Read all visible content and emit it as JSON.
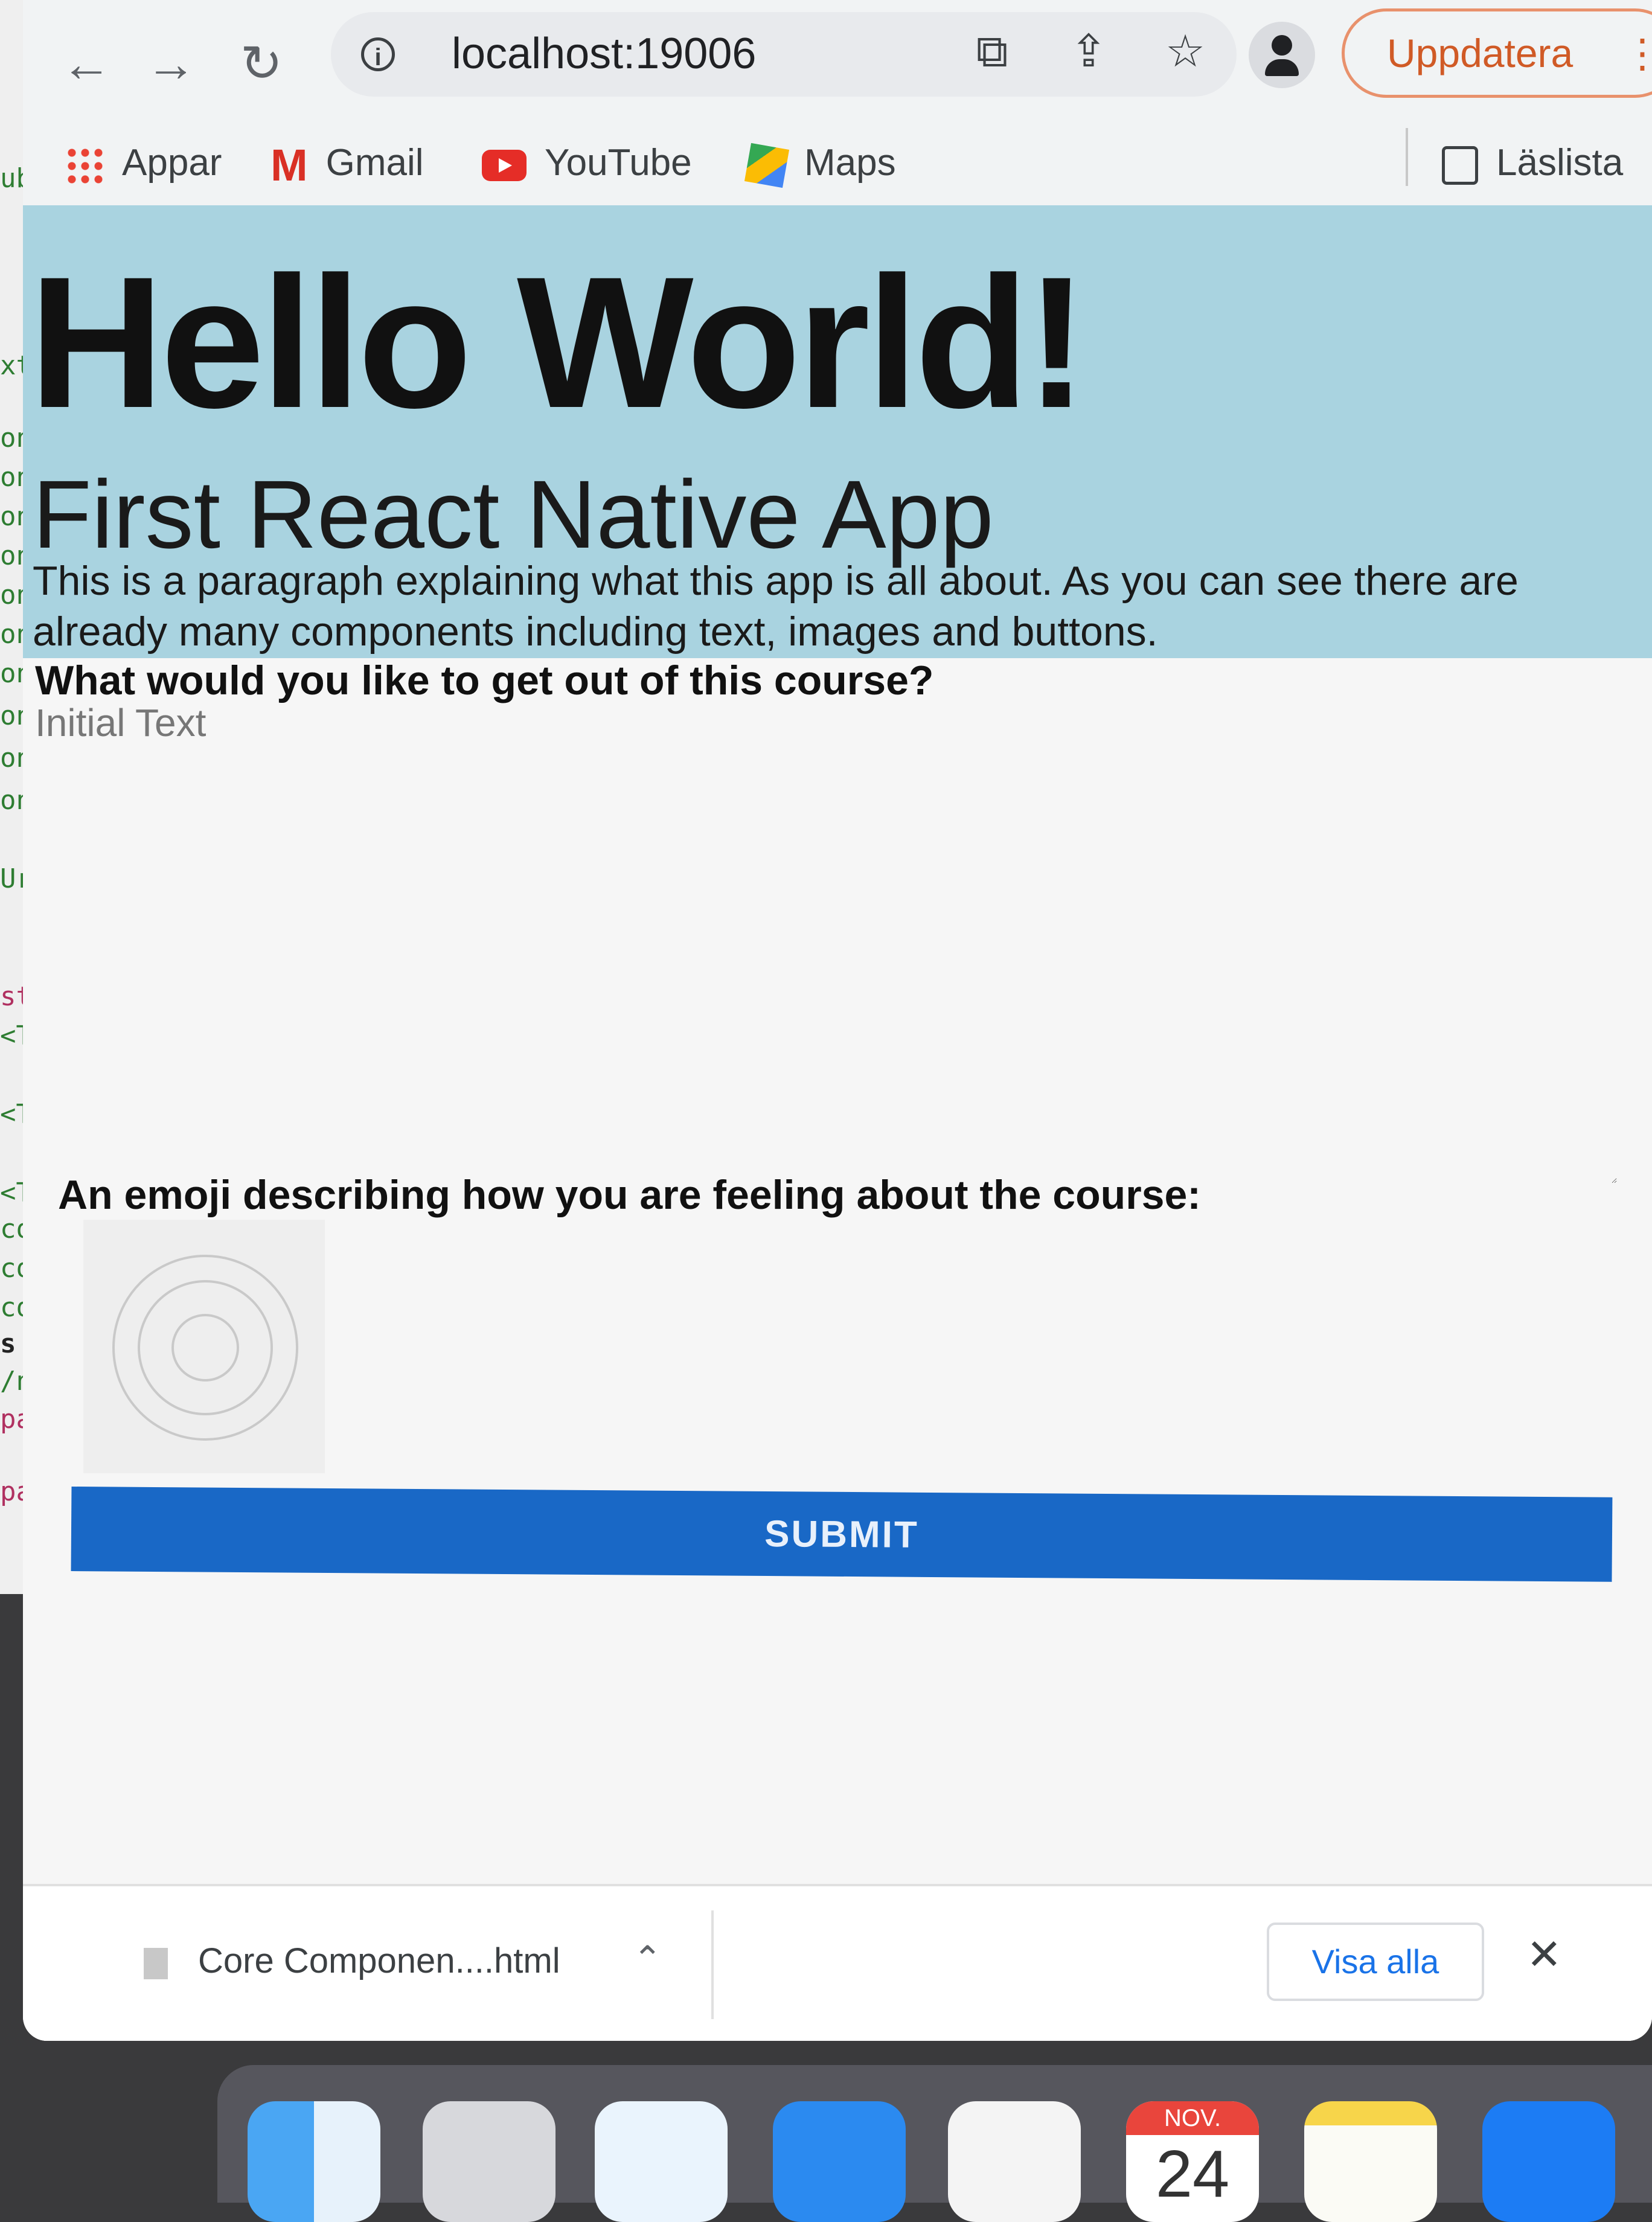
{
  "editor": {
    "lines": [
      "ub",
      "xt",
      "on",
      "on",
      "on",
      "on",
      "on",
      "on",
      "on",
      "on",
      "on",
      "on",
      "Ur",
      "sty",
      "<Te",
      "<Te",
      "<Te",
      "con",
      "con",
      "con",
      "s to",
      "/n)>",
      "pac",
      "pac"
    ]
  },
  "browser": {
    "nav": {
      "back_icon": "arrow-left-icon",
      "forward_icon": "arrow-right-icon",
      "reload_icon": "reload-icon"
    },
    "address": "localhost:19006",
    "update_label": "Uppdatera",
    "bookmarks": [
      {
        "label": "Appar",
        "icon": "apps-grid-icon"
      },
      {
        "label": "Gmail",
        "icon": "gmail-icon"
      },
      {
        "label": "YouTube",
        "icon": "youtube-icon"
      },
      {
        "label": "Maps",
        "icon": "maps-icon"
      }
    ],
    "reading_list": "Läslista"
  },
  "page": {
    "title": "Hello World!",
    "subtitle": "First React Native App",
    "paragraph": "This is a paragraph explaining what this app is all about. As you can see there are already many components including text, images and buttons.",
    "question": "What would you like to get out of this course?",
    "answer_value": "Initial Text",
    "emoji_label": "An emoji describing how you are feeling about the course:",
    "submit_label": "SUBMIT",
    "header_bg": "#a9d3e0",
    "button_color": "#1968c6"
  },
  "downloads": {
    "file_name": "Core Componen....html",
    "show_all": "Visa alla"
  },
  "dock": {
    "calendar_month": "NOV.",
    "calendar_day": "24",
    "apps": [
      "finder",
      "launchpad",
      "safari",
      "mail",
      "photos",
      "calendar",
      "notes",
      "app-store"
    ]
  }
}
